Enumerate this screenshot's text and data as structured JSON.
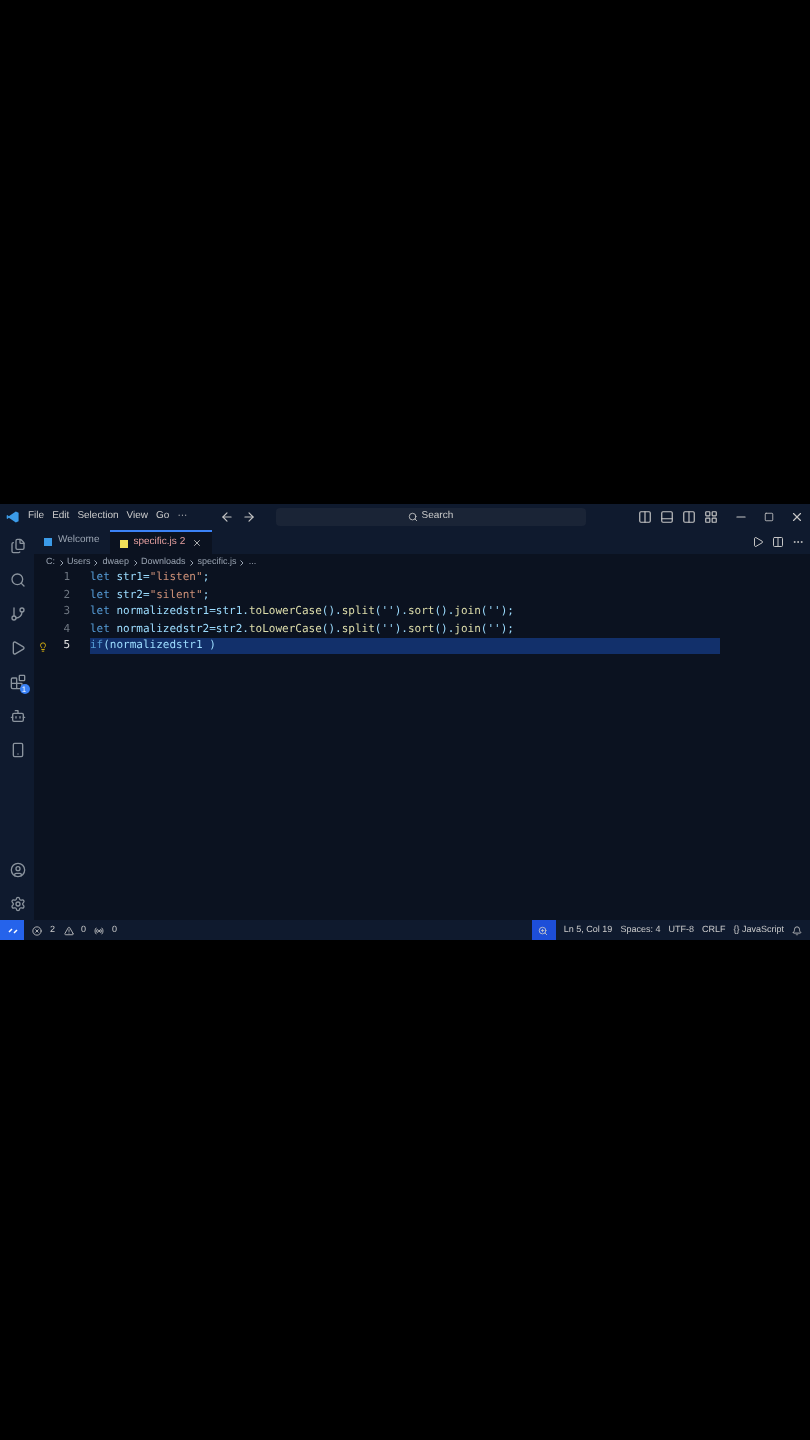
{
  "menu": [
    "File",
    "Edit",
    "Selection",
    "View",
    "Go",
    "···"
  ],
  "search": {
    "placeholder": "Search"
  },
  "tabs": [
    {
      "label": "Welcome",
      "selected": false
    },
    {
      "label": "specific.js",
      "selected": true,
      "badge": "2"
    }
  ],
  "breadcrumb": [
    "C:",
    "Users",
    "dwaep",
    "Downloads",
    "specific.js",
    "..."
  ],
  "activity_badge": "1",
  "code": [
    {
      "number": "1",
      "current": false,
      "tokens": [
        {
          "kind": "keyword",
          "text": "let"
        },
        {
          "kind": "plain",
          "text": " str1="
        },
        {
          "kind": "string",
          "text": "\"listen\""
        },
        {
          "kind": "plain",
          "text": ";"
        }
      ]
    },
    {
      "number": "2",
      "current": false,
      "tokens": [
        {
          "kind": "keyword",
          "text": "let"
        },
        {
          "kind": "plain",
          "text": " str2="
        },
        {
          "kind": "string",
          "text": "\"silent\""
        },
        {
          "kind": "plain",
          "text": ";"
        }
      ]
    },
    {
      "number": "3",
      "current": false,
      "tokens": [
        {
          "kind": "keyword",
          "text": "let"
        },
        {
          "kind": "plain",
          "text": " normalizedstr1=str1."
        },
        {
          "kind": "method",
          "text": "toLowerCase"
        },
        {
          "kind": "plain",
          "text": "()."
        },
        {
          "kind": "method",
          "text": "split"
        },
        {
          "kind": "plain",
          "text": "('')."
        },
        {
          "kind": "method",
          "text": "sort"
        },
        {
          "kind": "plain",
          "text": "()."
        },
        {
          "kind": "method",
          "text": "join"
        },
        {
          "kind": "plain",
          "text": "('');"
        }
      ]
    },
    {
      "number": "4",
      "current": false,
      "tokens": [
        {
          "kind": "keyword",
          "text": "let"
        },
        {
          "kind": "plain",
          "text": " normalizedstr2=str2."
        },
        {
          "kind": "method",
          "text": "toLowerCase"
        },
        {
          "kind": "plain",
          "text": "()."
        },
        {
          "kind": "method",
          "text": "split"
        },
        {
          "kind": "plain",
          "text": "('')."
        },
        {
          "kind": "method",
          "text": "sort"
        },
        {
          "kind": "plain",
          "text": "()."
        },
        {
          "kind": "method",
          "text": "join"
        },
        {
          "kind": "plain",
          "text": "('');"
        }
      ]
    },
    {
      "number": "5",
      "current": true,
      "tokens": [
        {
          "kind": "keyword",
          "text": "if"
        },
        {
          "kind": "plain",
          "text": "(normalizedstr1 )"
        }
      ]
    }
  ],
  "status_bar": {
    "errors": "2",
    "warnings": "0",
    "ports": "0",
    "right": [
      "Ln 5, Col 19",
      "Spaces: 4",
      "UTF-8",
      "CRLF",
      "{} JavaScript"
    ]
  }
}
